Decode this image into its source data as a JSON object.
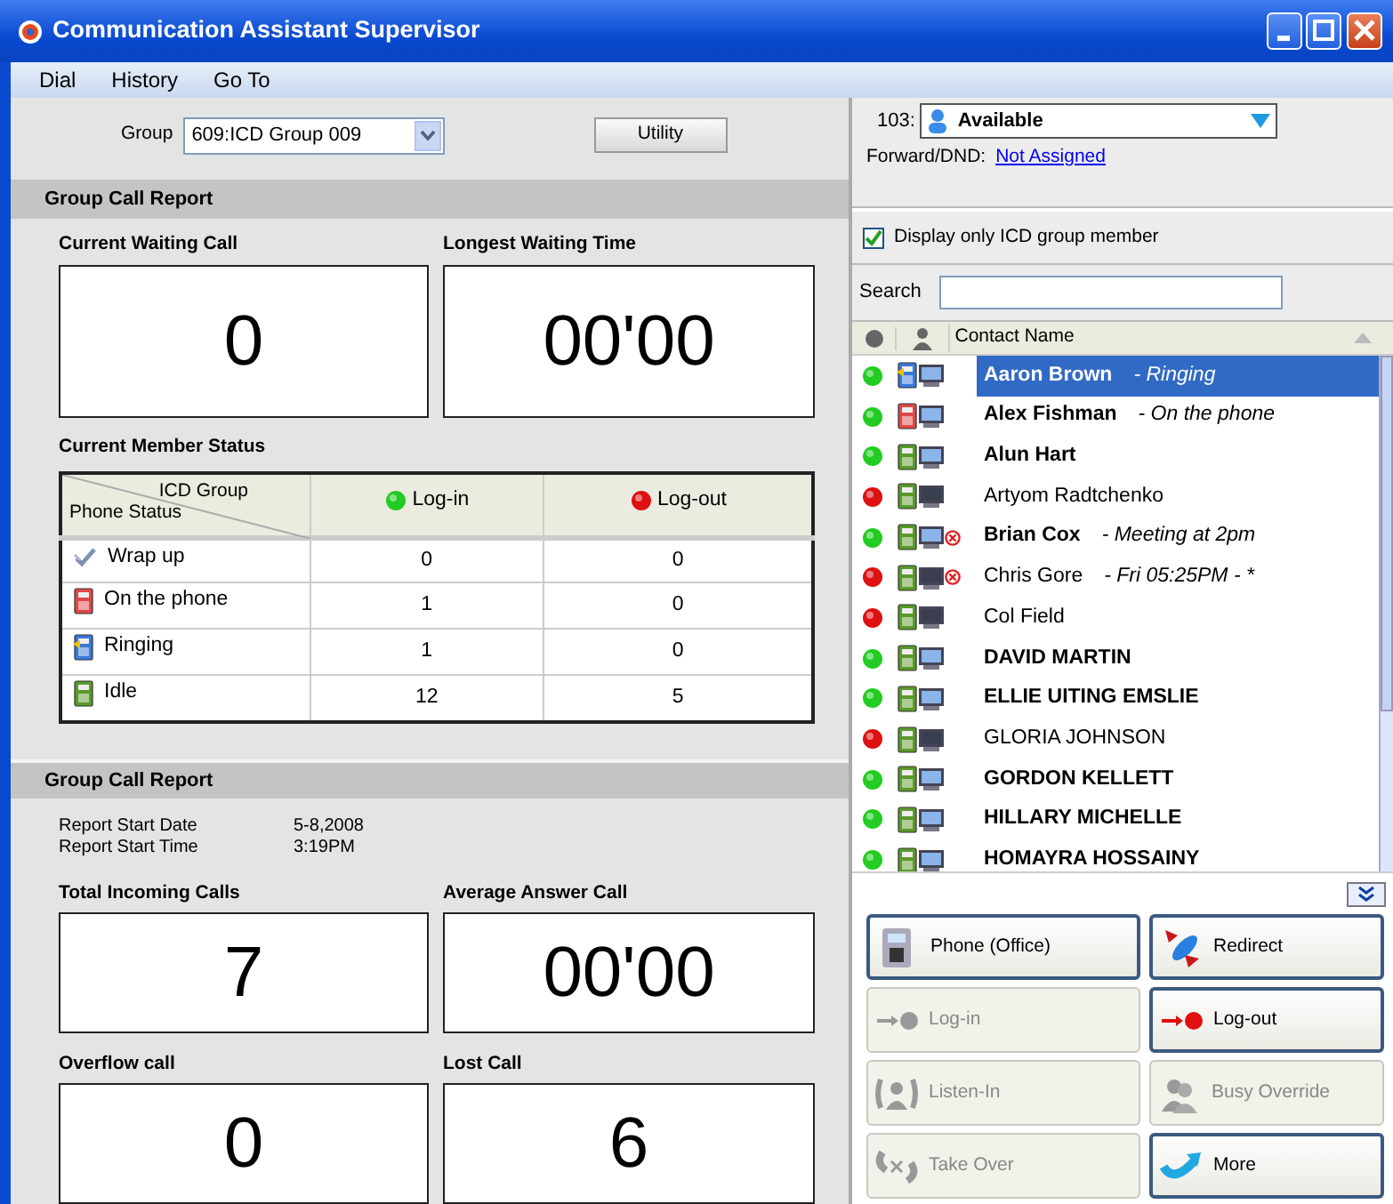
{
  "window": {
    "title": "Communication Assistant Supervisor"
  },
  "menu": [
    "Dial",
    "History",
    "Go To"
  ],
  "group": {
    "label": "Group",
    "value": "609:ICD Group 009"
  },
  "utility_button": "Utility",
  "waiting_report": {
    "title": "Group Call Report",
    "tiles": [
      {
        "label": "Current Waiting Call",
        "value": "0"
      },
      {
        "label": "Longest Waiting Time",
        "value": "00'00"
      }
    ]
  },
  "member_status": {
    "title": "Current Member Status",
    "corner_top": "ICD Group",
    "corner_bottom": "Phone Status",
    "columns": [
      {
        "label": "Log-in",
        "color": "#22cc22"
      },
      {
        "label": "Log-out",
        "color": "#dd1111"
      }
    ],
    "rows": [
      {
        "kind": "wrap_up",
        "label": "Wrap up",
        "values": [
          "0",
          "0"
        ]
      },
      {
        "kind": "on_phone",
        "label": "On the phone",
        "values": [
          "1",
          "0"
        ]
      },
      {
        "kind": "ringing",
        "label": "Ringing",
        "values": [
          "1",
          "0"
        ]
      },
      {
        "kind": "idle",
        "label": "Idle",
        "values": [
          "12",
          "5"
        ]
      }
    ]
  },
  "call_report": {
    "title": "Group Call Report",
    "info": [
      {
        "label": "Report Start Date",
        "value": "5-8,2008"
      },
      {
        "label": "Report Start Time",
        "value": "3:19PM"
      }
    ],
    "tiles": [
      {
        "label": "Total Incoming Calls",
        "value": "7"
      },
      {
        "label": "Average Answer Call",
        "value": "00'00"
      },
      {
        "label": "Overflow call",
        "value": "0"
      },
      {
        "label": "Lost Call",
        "value": "6"
      }
    ]
  },
  "presence": {
    "extension": "103:",
    "status": "Available",
    "forward_label": "Forward/DND:",
    "forward_link": "Not Assigned"
  },
  "filter": {
    "label": "Display only ICD group member",
    "checked": true
  },
  "search": {
    "label": "Search"
  },
  "contacts": {
    "column": "Contact Name",
    "rows": [
      {
        "name": "Aaron Brown",
        "note": "- Ringing",
        "logged_in": true,
        "kind": "ringing",
        "dnd": false,
        "selected": true
      },
      {
        "name": "Alex Fishman",
        "note": "- On the phone",
        "logged_in": true,
        "kind": "on_phone",
        "dnd": false,
        "selected": false
      },
      {
        "name": "Alun Hart",
        "logged_in": true,
        "kind": "idle",
        "dnd": false,
        "selected": false
      },
      {
        "name": "Artyom Radtchenko",
        "logged_in": false,
        "kind": "idle",
        "dnd": false,
        "selected": false
      },
      {
        "name": "Brian Cox",
        "note": "- Meeting at 2pm",
        "logged_in": true,
        "kind": "idle",
        "dnd": true,
        "selected": false
      },
      {
        "name": "Chris Gore",
        "note": "- Fri 05:25PM -  *",
        "logged_in": false,
        "kind": "idle",
        "dnd": true,
        "selected": false
      },
      {
        "name": "Col Field",
        "logged_in": false,
        "kind": "idle",
        "dnd": false,
        "selected": false
      },
      {
        "name": "DAVID MARTIN",
        "logged_in": true,
        "kind": "idle",
        "dnd": false,
        "selected": false
      },
      {
        "name": "ELLIE UITING EMSLIE",
        "logged_in": true,
        "kind": "idle",
        "dnd": false,
        "selected": false
      },
      {
        "name": "GLORIA JOHNSON",
        "logged_in": false,
        "kind": "idle",
        "dnd": false,
        "selected": false
      },
      {
        "name": "GORDON KELLETT",
        "logged_in": true,
        "kind": "idle",
        "dnd": false,
        "selected": false
      },
      {
        "name": "HILLARY MICHELLE",
        "logged_in": true,
        "kind": "idle",
        "dnd": false,
        "selected": false
      },
      {
        "name": "HOMAYRA HOSSAINY",
        "logged_in": true,
        "kind": "idle",
        "dnd": false,
        "selected": false
      }
    ]
  },
  "actions": [
    {
      "label": "Phone (Office)",
      "kind": "desk_phone",
      "disabled": false
    },
    {
      "label": "Redirect",
      "kind": "redirect",
      "disabled": false
    },
    {
      "label": "Log-in",
      "kind": "login",
      "disabled": true
    },
    {
      "label": "Log-out",
      "kind": "logout",
      "disabled": false
    },
    {
      "label": "Listen-In",
      "kind": "listen",
      "disabled": true
    },
    {
      "label": "Busy Override",
      "kind": "busy",
      "disabled": true
    },
    {
      "label": "Take Over",
      "kind": "takeover",
      "disabled": true
    },
    {
      "label": "More",
      "kind": "more",
      "disabled": false
    }
  ]
}
